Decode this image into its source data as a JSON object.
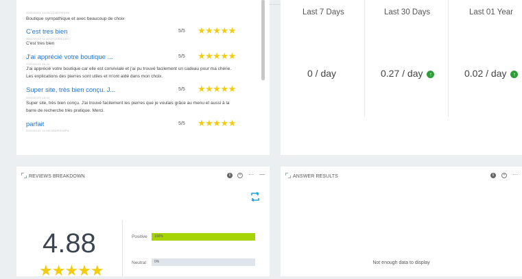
{
  "reviews": {
    "top_text": "Boutique sympathique et avec beaucoup de choix",
    "items": [
      {
        "title": "C'est tres bien",
        "score": "5/5",
        "stars": "★★★★★",
        "id": "2020/05/02 11:00/5XQNB9Q3D7",
        "text": "C'est tres bien"
      },
      {
        "title": "J'ai apprécié votre boutique ...",
        "score": "5/5",
        "stars": "★★★★★",
        "id": "2020/02/21 16:24",
        "text": "J'ai apprécié votre boutique car elle est conviviale et j'ai pu trouvé facilement un cadeau pour ma chérie. Les explications des pierres sont utiles et m'ont aidé dans mon choix."
      },
      {
        "title": "Super site, très bien conçu. J...",
        "score": "5/5",
        "stars": "★★★★★",
        "id": "2020/02/20 16:24",
        "text": "Super site, très bien conçu. J'ai trouvé facilement les pierres que je voulais grâce au menu et aussi à la barre de recherche très pratique. Merci."
      },
      {
        "title": "parfait",
        "score": "5/5",
        "stars": "★★★★★",
        "id": "2020/01/31 11:00/7Z6DR3V8PN",
        "text": ""
      }
    ]
  },
  "stats": {
    "columns": [
      {
        "label": "Last 7 Days",
        "value": "0 / day",
        "trend": ""
      },
      {
        "label": "Last 30 Days",
        "value": "0.27 / day",
        "trend": "up"
      },
      {
        "label": "Last 01 Year",
        "value": "0.02 / day",
        "trend": "up"
      }
    ]
  },
  "breakdown": {
    "title": "REVIEWS BREAKDOWN",
    "score": "4.88",
    "stars": "★★★★★",
    "bars": [
      {
        "label": "Positive",
        "pct_text": "100%",
        "fraction": 1.0,
        "color": "#a6d400"
      },
      {
        "label": "Neutral",
        "pct_text": "0%",
        "fraction": 0.0,
        "color": "#a6d400"
      }
    ]
  },
  "answer": {
    "title": "ANSWER RESULTS",
    "empty_text": "Not enough data to display"
  },
  "icons": {
    "info": "i",
    "plus": "+",
    "more": "···",
    "minimize": "—",
    "up_arrow": "↑"
  }
}
